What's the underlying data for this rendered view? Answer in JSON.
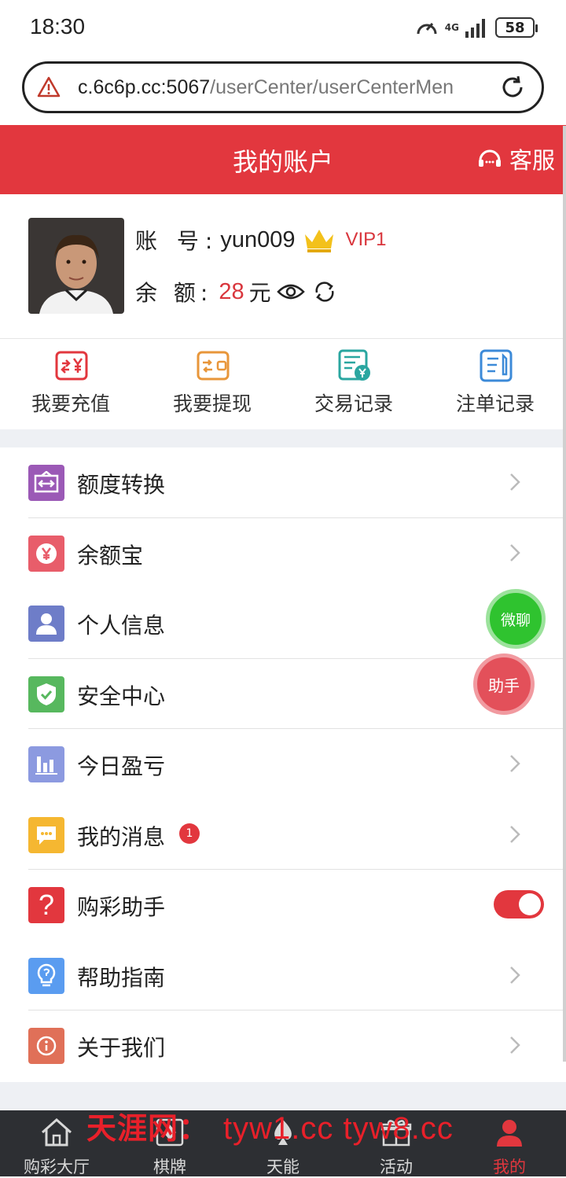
{
  "status_bar": {
    "time": "18:30",
    "network": "4G",
    "battery": "58"
  },
  "browser": {
    "url_host": "c.6c6p.cc:5067",
    "url_path": "/userCenter/userCenterMen"
  },
  "header": {
    "title": "我的账户",
    "service_label": "客服"
  },
  "profile": {
    "account_label": "账 号:",
    "account_name": "yun009",
    "vip_level": "VIP1",
    "balance_label": "余 额:",
    "balance_value": "28",
    "balance_unit": "元"
  },
  "quick_actions": [
    {
      "label": "我要充值",
      "icon": "recharge-yen-icon",
      "color": "#e2373e"
    },
    {
      "label": "我要提现",
      "icon": "withdraw-wallet-icon",
      "color": "#e8963a"
    },
    {
      "label": "交易记录",
      "icon": "transaction-record-icon",
      "color": "#2aa6a0"
    },
    {
      "label": "注单记录",
      "icon": "bet-record-icon",
      "color": "#3c8ad8"
    }
  ],
  "menu": [
    {
      "label": "额度转换",
      "icon": "transfer-icon",
      "color": "#9b59b6",
      "type": "link"
    },
    {
      "label": "余额宝",
      "icon": "yen-coin-icon",
      "color": "#e85d6a",
      "type": "link"
    },
    {
      "label": "个人信息",
      "icon": "user-icon",
      "color": "#6e7dc8",
      "type": "link"
    },
    {
      "label": "安全中心",
      "icon": "shield-icon",
      "color": "#57b85e",
      "type": "link"
    },
    {
      "label": "今日盈亏",
      "icon": "bar-chart-icon",
      "color": "#8c9ae0",
      "type": "link"
    },
    {
      "label": "我的消息",
      "icon": "message-icon",
      "color": "#f5b731",
      "type": "link",
      "badge": "1"
    },
    {
      "label": "购彩助手",
      "icon": "question-icon",
      "color": "#e2373e",
      "type": "toggle",
      "toggle_on": true
    },
    {
      "label": "帮助指南",
      "icon": "lightbulb-help-icon",
      "color": "#5a9cf0",
      "type": "link"
    },
    {
      "label": "关于我们",
      "icon": "info-icon",
      "color": "#e07058",
      "type": "link"
    }
  ],
  "floating": {
    "wechat_label": "微聊",
    "helper_label": "助手"
  },
  "tabbar": [
    {
      "label": "购彩大厅",
      "icon": "home-icon",
      "active": false
    },
    {
      "label": "棋牌",
      "icon": "cards-icon",
      "active": false
    },
    {
      "label": "天能",
      "icon": "spade-icon",
      "active": false
    },
    {
      "label": "活动",
      "icon": "gift-icon",
      "active": false
    },
    {
      "label": "我的",
      "icon": "user-icon",
      "active": true
    }
  ],
  "watermark": {
    "text": "天涯网：",
    "urls": "tyw1.cc tyw8.cc"
  },
  "colors": {
    "brand_red": "#e2373e",
    "tabbar_bg": "#2d2f33",
    "section_gap": "#eef0f4"
  }
}
